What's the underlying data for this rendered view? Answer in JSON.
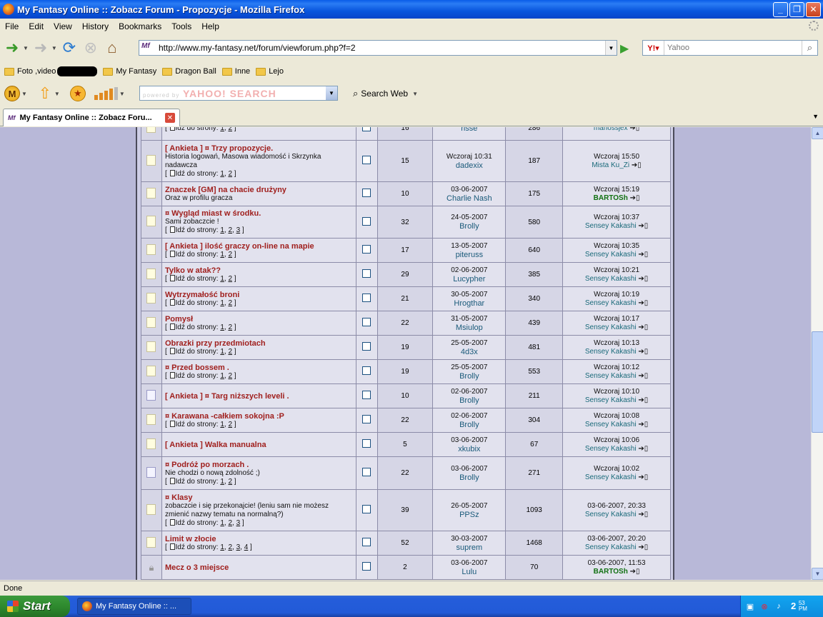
{
  "window": {
    "title": "My Fantasy Online :: Zobacz Forum - Propozycje - Mozilla Firefox"
  },
  "menu": [
    "File",
    "Edit",
    "View",
    "History",
    "Bookmarks",
    "Tools",
    "Help"
  ],
  "nav": {
    "url": "http://www.my-fantasy.net/forum/viewforum.php?f=2",
    "search_placeholder": "Yahoo"
  },
  "bookmarks": [
    {
      "label": "Foto ,video",
      "redacted": true
    },
    {
      "label": "My Fantasy"
    },
    {
      "label": "Dragon Ball"
    },
    {
      "label": "Inne"
    },
    {
      "label": "Lejo"
    }
  ],
  "yahoo_toolbar": {
    "search_placeholder": "YAHOO! SEARCH",
    "powered_by": "powered by",
    "search_web_label": "Search Web"
  },
  "tab": {
    "label": "My Fantasy Online :: Zobacz Foru..."
  },
  "topics": [
    {
      "title": "",
      "desc": "",
      "pages": [
        "1",
        "2"
      ],
      "replies": "16",
      "author_date": "",
      "author": "risse",
      "views": "286",
      "last_date": "",
      "last_user": "mariossjex",
      "last_user_mod": false,
      "icon": "normal"
    },
    {
      "title": "[ Ankieta ] ¤ Trzy propozycje.",
      "desc": "Historia logowań, Masowa wiadomość i Skrzynka nadawcza",
      "pages": [
        "1",
        "2"
      ],
      "replies": "15",
      "author_date": "Wczoraj 10:31",
      "author": "dadexix",
      "views": "187",
      "last_date": "Wczoraj 15:50",
      "last_user": "Mista Ku_Zi",
      "last_user_mod": false,
      "icon": "normal"
    },
    {
      "title": "Znaczek [GM] na chacie drużyny",
      "desc": "Oraz w profilu gracza",
      "pages": [],
      "replies": "10",
      "author_date": "03-06-2007",
      "author": "Charlie Nash",
      "views": "175",
      "last_date": "Wczoraj 15:19",
      "last_user": "BARTOSh",
      "last_user_mod": true,
      "icon": "normal"
    },
    {
      "title": "¤ Wygląd miast w środku.",
      "desc": "Sami zobaczcie !",
      "pages": [
        "1",
        "2",
        "3"
      ],
      "replies": "32",
      "author_date": "24-05-2007",
      "author": "Brolly",
      "views": "580",
      "last_date": "Wczoraj 10:37",
      "last_user": "Sensey Kakashi",
      "last_user_mod": false,
      "icon": "normal"
    },
    {
      "title": "[ Ankieta ] ilość graczy on-line na mapie",
      "desc": "",
      "pages": [
        "1",
        "2"
      ],
      "replies": "17",
      "author_date": "13-05-2007",
      "author": "piteruss",
      "views": "640",
      "last_date": "Wczoraj 10:35",
      "last_user": "Sensey Kakashi",
      "last_user_mod": false,
      "icon": "normal"
    },
    {
      "title": "Tylko w atak??",
      "desc": "",
      "pages": [
        "1",
        "2"
      ],
      "replies": "29",
      "author_date": "02-06-2007",
      "author": "Lucypher",
      "views": "385",
      "last_date": "Wczoraj 10:21",
      "last_user": "Sensey Kakashi",
      "last_user_mod": false,
      "icon": "normal"
    },
    {
      "title": "Wytrzymałość broni",
      "desc": "",
      "pages": [
        "1",
        "2"
      ],
      "replies": "21",
      "author_date": "30-05-2007",
      "author": "Hrogthar",
      "views": "340",
      "last_date": "Wczoraj 10:19",
      "last_user": "Sensey Kakashi",
      "last_user_mod": false,
      "icon": "normal"
    },
    {
      "title": "Pomysł",
      "desc": "",
      "pages": [
        "1",
        "2"
      ],
      "replies": "22",
      "author_date": "31-05-2007",
      "author": "Msiulop",
      "views": "439",
      "last_date": "Wczoraj 10:17",
      "last_user": "Sensey Kakashi",
      "last_user_mod": false,
      "icon": "normal"
    },
    {
      "title": "Obrazki przy przedmiotach",
      "desc": "",
      "pages": [
        "1",
        "2"
      ],
      "replies": "19",
      "author_date": "25-05-2007",
      "author": "4d3x",
      "views": "481",
      "last_date": "Wczoraj 10:13",
      "last_user": "Sensey Kakashi",
      "last_user_mod": false,
      "icon": "normal"
    },
    {
      "title": "¤ Przed bossem .",
      "desc": "",
      "pages": [
        "1",
        "2"
      ],
      "replies": "19",
      "author_date": "25-05-2007",
      "author": "Brolly",
      "views": "553",
      "last_date": "Wczoraj 10:12",
      "last_user": "Sensey Kakashi",
      "last_user_mod": false,
      "icon": "normal"
    },
    {
      "title": "[ Ankieta ] ¤ Targ niższych leveli .",
      "desc": "",
      "pages": [],
      "replies": "10",
      "author_date": "02-06-2007",
      "author": "Brolly",
      "views": "211",
      "last_date": "Wczoraj 10:10",
      "last_user": "Sensey Kakashi",
      "last_user_mod": false,
      "icon": "new"
    },
    {
      "title": "¤ Karawana -całkiem sokojna :P",
      "desc": "",
      "pages": [
        "1",
        "2"
      ],
      "replies": "22",
      "author_date": "02-06-2007",
      "author": "Brolly",
      "views": "304",
      "last_date": "Wczoraj 10:08",
      "last_user": "Sensey Kakashi",
      "last_user_mod": false,
      "icon": "normal"
    },
    {
      "title": "[ Ankieta ] Walka manualna",
      "desc": "",
      "pages": [],
      "replies": "5",
      "author_date": "03-06-2007",
      "author": "xkubix",
      "views": "67",
      "last_date": "Wczoraj 10:06",
      "last_user": "Sensey Kakashi",
      "last_user_mod": false,
      "icon": "normal"
    },
    {
      "title": "¤ Podróż po morzach .",
      "desc": "Nie chodzi o nową zdolność ;)",
      "pages": [
        "1",
        "2"
      ],
      "replies": "22",
      "author_date": "03-06-2007",
      "author": "Brolly",
      "views": "271",
      "last_date": "Wczoraj 10:02",
      "last_user": "Sensey Kakashi",
      "last_user_mod": false,
      "icon": "new"
    },
    {
      "title": "¤ Klasy",
      "desc": "zobaczcie i się przekonajcie! (leniu sam nie możesz zmienić nazwy tematu na normalną?)",
      "pages": [
        "1",
        "2",
        "3"
      ],
      "replies": "39",
      "author_date": "26-05-2007",
      "author": "PPSz",
      "views": "1093",
      "last_date": "03-06-2007, 20:33",
      "last_user": "Sensey Kakashi",
      "last_user_mod": false,
      "icon": "normal"
    },
    {
      "title": "Limit w złocie",
      "desc": "",
      "pages": [
        "1",
        "2",
        "3",
        "4"
      ],
      "replies": "52",
      "author_date": "30-03-2007",
      "author": "suprem",
      "views": "1468",
      "last_date": "03-06-2007, 20:20",
      "last_user": "Sensey Kakashi",
      "last_user_mod": false,
      "icon": "normal"
    },
    {
      "title": "Mecz o 3 miejsce",
      "desc": "",
      "pages": [],
      "replies": "2",
      "author_date": "03-06-2007",
      "author": "Lulu",
      "views": "70",
      "last_date": "03-06-2007, 11:53",
      "last_user": "BARTOSh",
      "last_user_mod": true,
      "icon": "lock"
    }
  ],
  "strings": {
    "goto_page": "Idź do strony:"
  },
  "status": {
    "text": "Done"
  },
  "taskbar": {
    "start": "Start",
    "item": "My Fantasy Online :: ...",
    "clock": "2",
    "clock_small": "53",
    "ampm": "PM"
  }
}
